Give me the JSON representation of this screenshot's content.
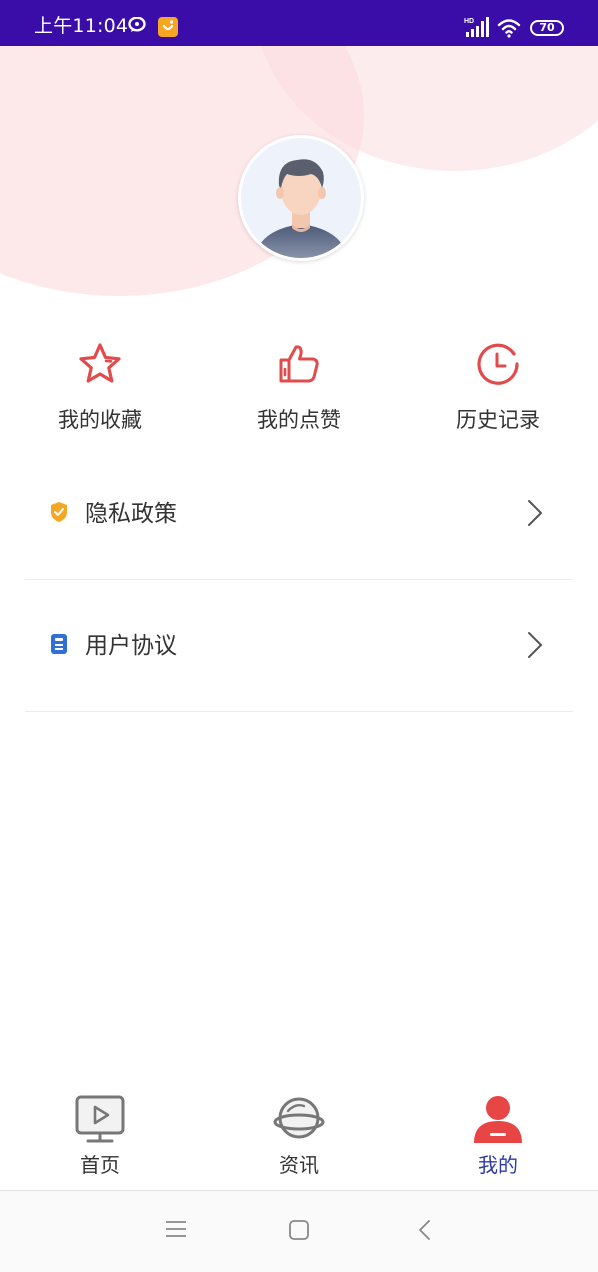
{
  "status_bar": {
    "time": "上午11:04",
    "battery": "70"
  },
  "quick_actions": [
    {
      "label": "我的收藏",
      "icon": "star-icon"
    },
    {
      "label": "我的点赞",
      "icon": "thumbs-up-icon"
    },
    {
      "label": "历史记录",
      "icon": "clock-icon"
    }
  ],
  "menu": [
    {
      "label": "隐私政策",
      "icon": "shield-icon"
    },
    {
      "label": "用户协议",
      "icon": "document-icon"
    }
  ],
  "tabs": [
    {
      "label": "首页",
      "icon": "tv-play-icon",
      "active": false
    },
    {
      "label": "资讯",
      "icon": "planet-icon",
      "active": false
    },
    {
      "label": "我的",
      "icon": "user-icon",
      "active": true
    }
  ],
  "colors": {
    "status_bar": "#3a0ca8",
    "accent_red": "#e24b4b",
    "active_tab": "#2d3ba8",
    "hero_pink": "#fde9ea",
    "shield_orange": "#f5a623",
    "doc_blue": "#2f6fd6"
  }
}
